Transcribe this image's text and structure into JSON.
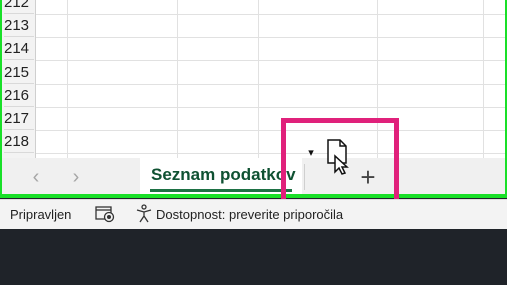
{
  "rows": [
    "212",
    "213",
    "214",
    "215",
    "216",
    "217",
    "218"
  ],
  "sheet_tabs": [
    {
      "label": "Seznam podatkov",
      "active": true
    }
  ],
  "tabbar": {
    "prev_icon": "chevron-left-icon",
    "next_icon": "chevron-right-icon",
    "prev_glyph": "‹",
    "next_glyph": "›",
    "menu_glyph": "▾",
    "add_glyph": "+"
  },
  "statusbar": {
    "status": "Pripravljen",
    "accessibility": "Dostopnost: preverite priporočila"
  },
  "colors": {
    "highlight_green": "#19e028",
    "highlight_pink": "#e0217b",
    "active_tab_text": "#0f5132"
  }
}
